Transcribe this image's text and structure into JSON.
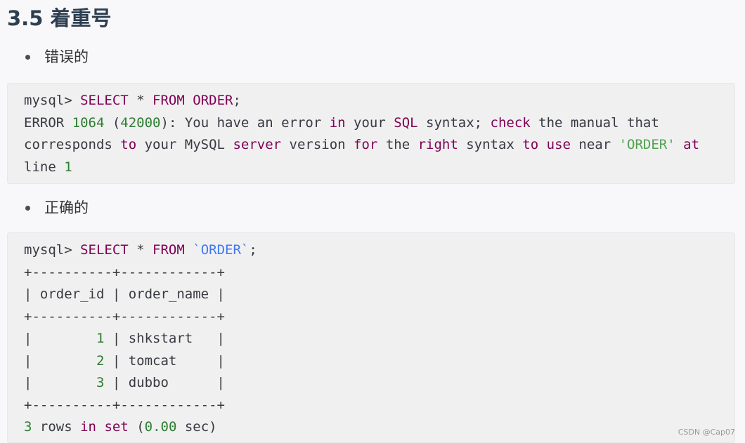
{
  "heading": "3.5 着重号",
  "wrong_label": "错误的",
  "right_label": "正确的",
  "wrong_code": [
    [
      {
        "t": "mysql> ",
        "c": "plain"
      },
      {
        "t": "SELECT",
        "c": "kw2"
      },
      {
        "t": " * ",
        "c": "plain"
      },
      {
        "t": "FROM",
        "c": "kw2"
      },
      {
        "t": " ",
        "c": "plain"
      },
      {
        "t": "ORDER",
        "c": "kw2"
      },
      {
        "t": ";",
        "c": "plain"
      }
    ],
    [
      {
        "t": "ERROR ",
        "c": "plain"
      },
      {
        "t": "1064",
        "c": "num"
      },
      {
        "t": " (",
        "c": "plain"
      },
      {
        "t": "42000",
        "c": "num"
      },
      {
        "t": "): You have an error ",
        "c": "plain"
      },
      {
        "t": "in",
        "c": "kw2"
      },
      {
        "t": " your ",
        "c": "plain"
      },
      {
        "t": "SQL",
        "c": "kw2"
      },
      {
        "t": " syntax; ",
        "c": "plain"
      },
      {
        "t": "check",
        "c": "kw2"
      },
      {
        "t": " the manual that",
        "c": "plain"
      }
    ],
    [
      {
        "t": "corresponds ",
        "c": "plain"
      },
      {
        "t": "to",
        "c": "kw2"
      },
      {
        "t": " your MySQL ",
        "c": "plain"
      },
      {
        "t": "server",
        "c": "kw2"
      },
      {
        "t": " version ",
        "c": "plain"
      },
      {
        "t": "for",
        "c": "kw2"
      },
      {
        "t": " the ",
        "c": "plain"
      },
      {
        "t": "right",
        "c": "kw2"
      },
      {
        "t": " syntax ",
        "c": "plain"
      },
      {
        "t": "to",
        "c": "kw2"
      },
      {
        "t": " ",
        "c": "plain"
      },
      {
        "t": "use",
        "c": "kw2"
      },
      {
        "t": " near ",
        "c": "plain"
      },
      {
        "t": "'ORDER'",
        "c": "str"
      },
      {
        "t": " ",
        "c": "plain"
      },
      {
        "t": "at",
        "c": "kw2"
      }
    ],
    [
      {
        "t": "line ",
        "c": "plain"
      },
      {
        "t": "1",
        "c": "num"
      }
    ]
  ],
  "right_code": [
    [
      {
        "t": "mysql> ",
        "c": "plain"
      },
      {
        "t": "SELECT",
        "c": "kw2"
      },
      {
        "t": " * ",
        "c": "plain"
      },
      {
        "t": "FROM",
        "c": "kw2"
      },
      {
        "t": " ",
        "c": "plain"
      },
      {
        "t": "`ORDER`",
        "c": "tick"
      },
      {
        "t": ";",
        "c": "plain"
      }
    ],
    [
      {
        "t": "+----------+------------+",
        "c": "plain"
      }
    ],
    [
      {
        "t": "| order_id | order_name |",
        "c": "plain"
      }
    ],
    [
      {
        "t": "+----------+------------+",
        "c": "plain"
      }
    ],
    [
      {
        "t": "|        ",
        "c": "plain"
      },
      {
        "t": "1",
        "c": "num"
      },
      {
        "t": " | shkstart   |",
        "c": "plain"
      }
    ],
    [
      {
        "t": "|        ",
        "c": "plain"
      },
      {
        "t": "2",
        "c": "num"
      },
      {
        "t": " | tomcat     |",
        "c": "plain"
      }
    ],
    [
      {
        "t": "|        ",
        "c": "plain"
      },
      {
        "t": "3",
        "c": "num"
      },
      {
        "t": " | dubbo      |",
        "c": "plain"
      }
    ],
    [
      {
        "t": "+----------+------------+",
        "c": "plain"
      }
    ],
    [
      {
        "t": "3",
        "c": "num"
      },
      {
        "t": " rows ",
        "c": "plain"
      },
      {
        "t": "in",
        "c": "kw2"
      },
      {
        "t": " ",
        "c": "plain"
      },
      {
        "t": "set",
        "c": "kw2"
      },
      {
        "t": " (",
        "c": "plain"
      },
      {
        "t": "0.00",
        "c": "num"
      },
      {
        "t": " sec)",
        "c": "plain"
      }
    ]
  ],
  "watermark": "CSDN @Cap07",
  "colors": {
    "keyword": "#7f0055",
    "number": "#2e7d32",
    "string": "#50a14f",
    "backtick": "#4078f2"
  }
}
